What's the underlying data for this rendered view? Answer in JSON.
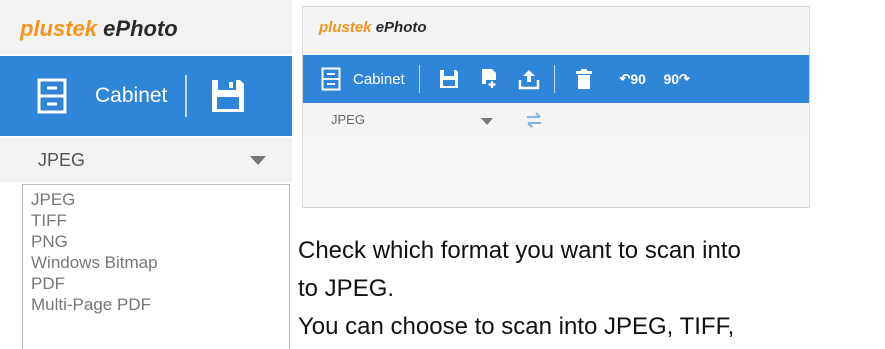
{
  "left": {
    "brand_part1": "plustek",
    "brand_part2": "ePhoto",
    "toolbar": {
      "cabinet_label": "Cabinet"
    },
    "format_selected": "JPEG",
    "format_options": [
      "JPEG",
      "TIFF",
      "PNG",
      "Windows Bitmap",
      "PDF",
      "Multi-Page PDF"
    ]
  },
  "right": {
    "brand_part1": "plustek",
    "brand_part2": "ePhoto",
    "toolbar": {
      "cabinet_label": "Cabinet",
      "rotate_left_label": "90",
      "rotate_right_label": "90"
    },
    "format_selected": "JPEG"
  },
  "document": {
    "line1": "Check which format you want to scan into",
    "line2": "to JPEG.",
    "line3": "You can choose to scan into JPEG, TIFF,"
  },
  "colors": {
    "accent": "#2f86d8",
    "brand_orange": "#f7941d"
  }
}
